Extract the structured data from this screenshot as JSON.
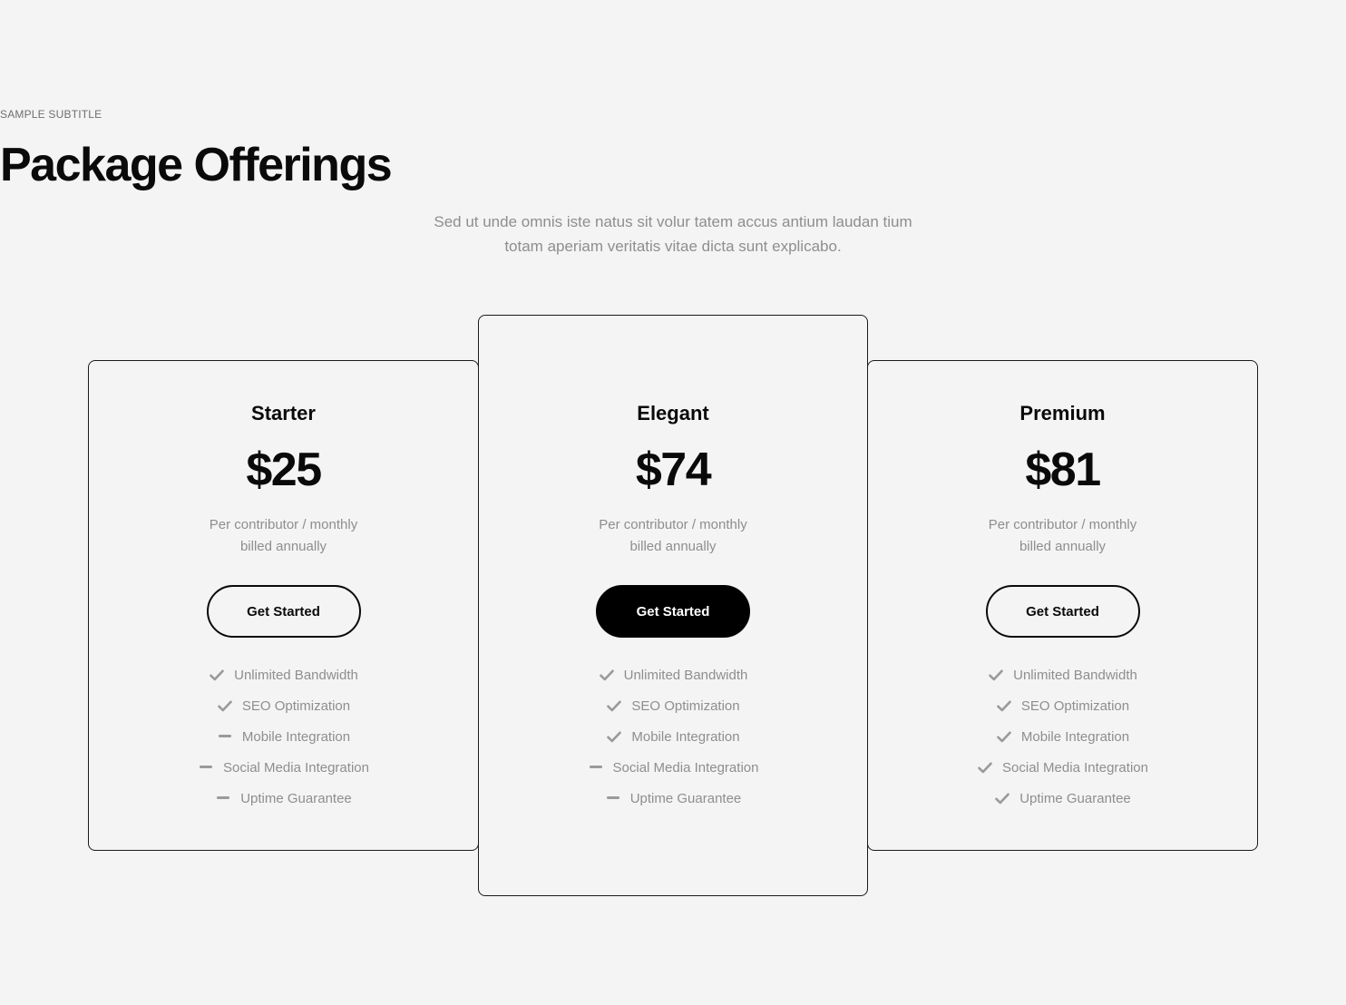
{
  "header": {
    "subtitle": "SAMPLE SUBTITLE",
    "title": "Package Offerings",
    "description_line1": "Sed ut unde omnis iste natus sit volur tatem accus antium laudan tium",
    "description_line2": "totam aperiam veritatis vitae dicta sunt explicabo."
  },
  "colors": {
    "background": "#f4f4f4",
    "text_dark": "#0a0a0a",
    "text_muted": "#8e8e8e",
    "icon": "#9a9a9a"
  },
  "plans": [
    {
      "name": "Starter",
      "price": "$25",
      "billing_line1": "Per contributor / monthly",
      "billing_line2": "billed annually",
      "button_label": "Get Started",
      "features": [
        {
          "label": "Unlimited Bandwidth",
          "icon": "check-icon"
        },
        {
          "label": "SEO Optimization",
          "icon": "check-icon"
        },
        {
          "label": "Mobile Integration",
          "icon": "dash-icon"
        },
        {
          "label": "Social Media Integration",
          "icon": "dash-icon"
        },
        {
          "label": "Uptime Guarantee",
          "icon": "dash-icon"
        }
      ]
    },
    {
      "name": "Elegant",
      "price": "$74",
      "billing_line1": "Per contributor / monthly",
      "billing_line2": "billed annually",
      "button_label": "Get Started",
      "features": [
        {
          "label": "Unlimited Bandwidth",
          "icon": "check-icon"
        },
        {
          "label": "SEO Optimization",
          "icon": "check-icon"
        },
        {
          "label": "Mobile Integration",
          "icon": "check-icon"
        },
        {
          "label": "Social Media Integration",
          "icon": "dash-icon"
        },
        {
          "label": "Uptime Guarantee",
          "icon": "dash-icon"
        }
      ]
    },
    {
      "name": "Premium",
      "price": "$81",
      "billing_line1": "Per contributor / monthly",
      "billing_line2": "billed annually",
      "button_label": "Get Started",
      "features": [
        {
          "label": "Unlimited Bandwidth",
          "icon": "check-icon"
        },
        {
          "label": "SEO Optimization",
          "icon": "check-icon"
        },
        {
          "label": "Mobile Integration",
          "icon": "check-icon"
        },
        {
          "label": "Social Media Integration",
          "icon": "check-icon"
        },
        {
          "label": "Uptime Guarantee",
          "icon": "check-icon"
        }
      ]
    }
  ]
}
